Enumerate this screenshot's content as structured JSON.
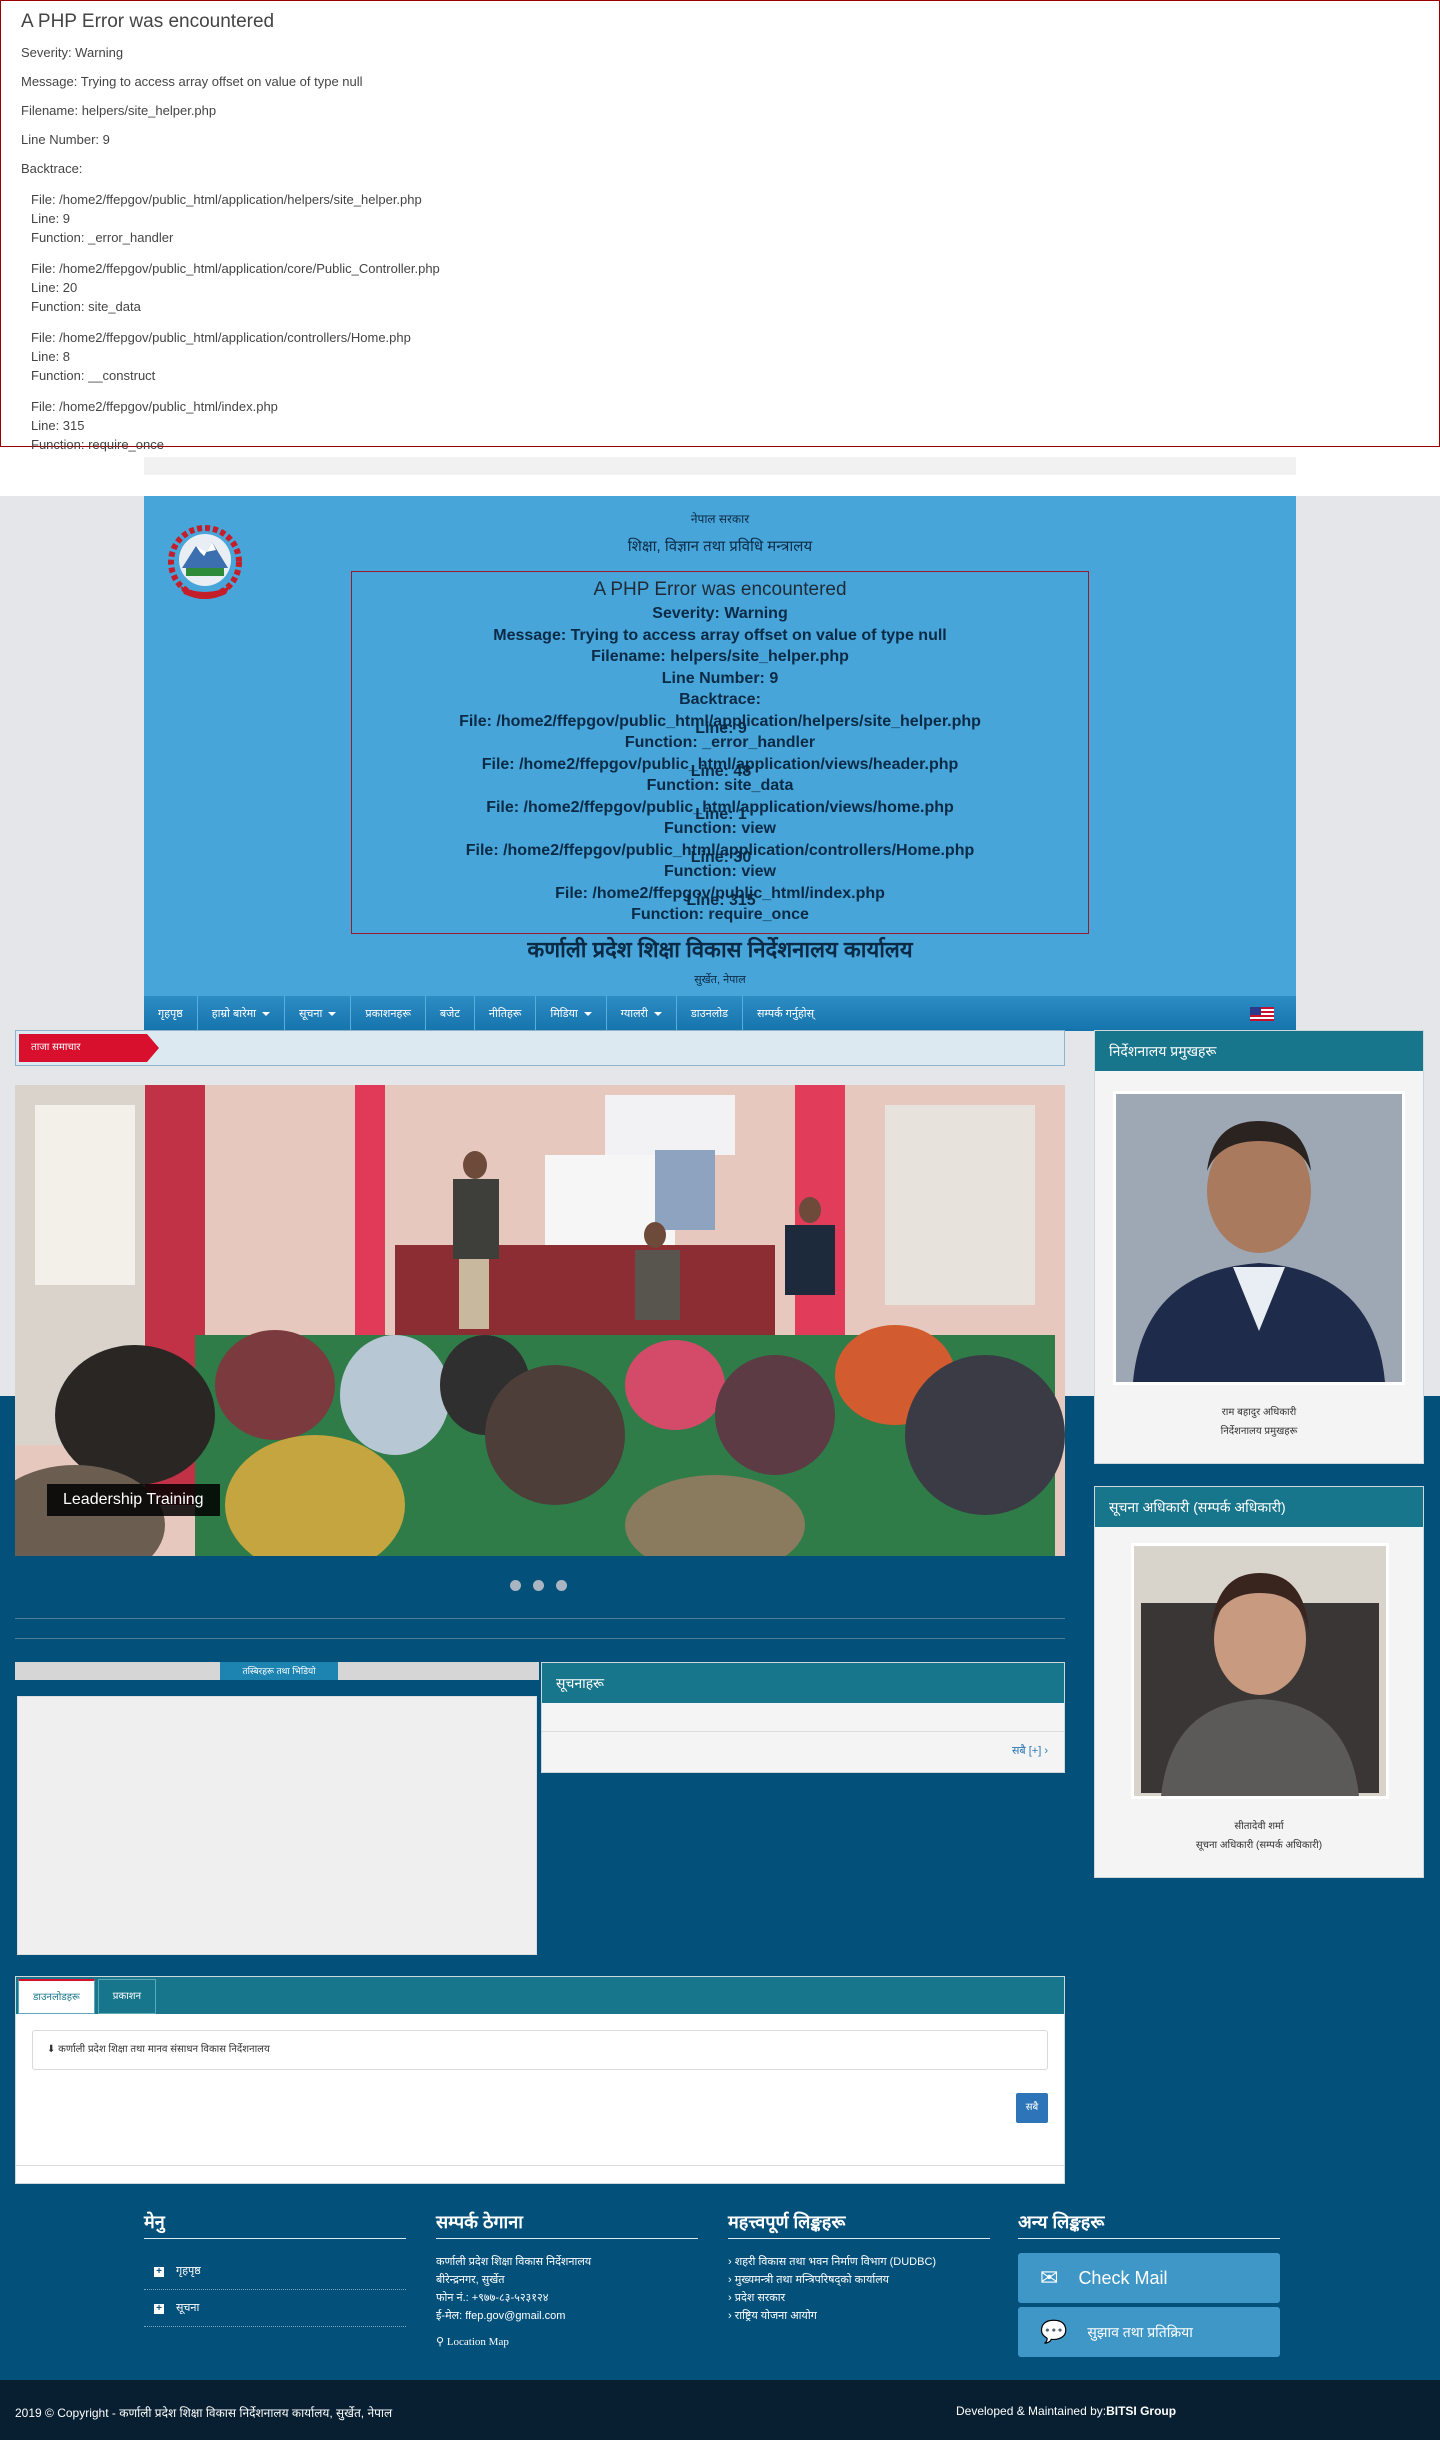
{
  "php_error_top": {
    "title": "A PHP Error was encountered",
    "severity": "Severity: Warning",
    "message": "Message: Trying to access array offset on value of type null",
    "filename": "Filename: helpers/site_helper.php",
    "line_number": "Line Number: 9",
    "backtrace_label": "Backtrace:",
    "backtrace": [
      {
        "file": "File: /home2/ffepgov/public_html/application/helpers/site_helper.php",
        "line": "Line: 9",
        "function": "Function: _error_handler"
      },
      {
        "file": "File: /home2/ffepgov/public_html/application/core/Public_Controller.php",
        "line": "Line: 20",
        "function": "Function: site_data"
      },
      {
        "file": "File: /home2/ffepgov/public_html/application/controllers/Home.php",
        "line": "Line: 8",
        "function": "Function: __construct"
      },
      {
        "file": "File: /home2/ffepgov/public_html/index.php",
        "line": "Line: 315",
        "function": "Function: require_once"
      }
    ]
  },
  "header": {
    "gov_line1": "नेपाल सरकार",
    "gov_line2": "शिक्षा, विज्ञान तथा प्रविधि मन्त्रालय",
    "office_name": "कर्णाली प्रदेश शिक्षा विकास निर्देशनालय कार्यालय",
    "office_location": "सुर्खेत, नेपाल",
    "inner_error": {
      "title": "A PHP Error was encountered",
      "lines": [
        "Severity: Warning",
        "Message: Trying to access array offset on value of type null",
        "Filename: helpers/site_helper.php",
        "Line Number: 9",
        "Backtrace:",
        "File: /home2/ffepgov/public_html/application/helpers/site_helper.php",
        "Function: _error_handler",
        "File: /home2/ffepgov/public_html/application/views/header.php",
        "Function: site_data",
        "File: /home2/ffepgov/public_html/application/views/home.php",
        "Function: view",
        "File: /home2/ffepgov/public_html/application/controllers/Home.php",
        "Function: view",
        "File: /home2/ffepgov/public_html/index.php",
        "Function: require_once"
      ],
      "overlaps": [
        "Line: 9",
        "Line: 48",
        "Line: 1",
        "Line: 30",
        "Line: 315"
      ]
    }
  },
  "nav": {
    "items": [
      {
        "label": "गृहपृष्ठ",
        "dropdown": false
      },
      {
        "label": "हाम्रो बारेमा",
        "dropdown": true
      },
      {
        "label": "सूचना",
        "dropdown": true
      },
      {
        "label": "प्रकाशनहरू",
        "dropdown": false
      },
      {
        "label": "बजेट",
        "dropdown": false
      },
      {
        "label": "नीतिहरू",
        "dropdown": false
      },
      {
        "label": "मिडिया",
        "dropdown": true
      },
      {
        "label": "ग्यालरी",
        "dropdown": true
      },
      {
        "label": "डाउनलोड",
        "dropdown": false
      },
      {
        "label": "सम्पर्क गर्नुहोस्",
        "dropdown": false
      }
    ]
  },
  "ticker": {
    "label": "ताजा समाचार"
  },
  "slider": {
    "caption": "Leadership Training",
    "dot_count": 3
  },
  "gallery": {
    "label": "तस्बिरहरू तथा भिडियो"
  },
  "notice": {
    "title": "सूचनाहरू",
    "more": "सबै [+]"
  },
  "tabs": {
    "items": [
      "डाउनलोडहरू",
      "प्रकाशन"
    ],
    "doc_text": "कर्णाली प्रदेश शिक्षा तथा मानव संसाधन विकास निर्देशनालय",
    "button": "सबै"
  },
  "sidebar": {
    "chief": {
      "title": "निर्देशनालय प्रमुखहरू",
      "name": "राम बहादुर अधिकारी",
      "role": "निर्देशनालय प्रमुखहरू"
    },
    "info_officer": {
      "title": "सूचना अधिकारी (सम्पर्क अधिकारी)",
      "name": "सीतादेवी शर्मा",
      "role": "सूचना अधिकारी (सम्पर्क अधिकारी)"
    }
  },
  "footer": {
    "col1": {
      "title": "मेनु",
      "items": [
        "गृहपृष्ठ",
        "सूचना"
      ]
    },
    "col2": {
      "title": "सम्पर्क ठेगाना",
      "lines": [
        "कर्णाली प्रदेश शिक्षा विकास निर्देशनालय",
        "बीरेन्द्रनगर, सुर्खेत",
        "फोन नं.: +९७७-८३-५२३१२४",
        "ई-मेल: ffep.gov@gmail.com"
      ],
      "map": "Location Map"
    },
    "col3": {
      "title": "महत्त्वपूर्ण लिङ्कहरू",
      "links": [
        "शहरी विकास तथा भवन निर्माण विभाग (DUDBC)",
        "मुख्यमन्त्री तथा मन्त्रिपरिषद्को कार्यालय",
        "प्रदेश सरकार",
        "राष्ट्रिय योजना आयोग"
      ]
    },
    "col4": {
      "title": "अन्य लिङ्कहरू",
      "mail": "Check Mail",
      "feedback": "सुझाव तथा प्रतिक्रिया"
    }
  },
  "bottom": {
    "copyright": "2019 © Copyright - कर्णाली प्रदेश शिक्षा विकास निर्देशनालय कार्यालय, सुर्खेत, नेपाल",
    "developer_label": "Developed & Maintained by:",
    "developer": "BITSI Group"
  }
}
